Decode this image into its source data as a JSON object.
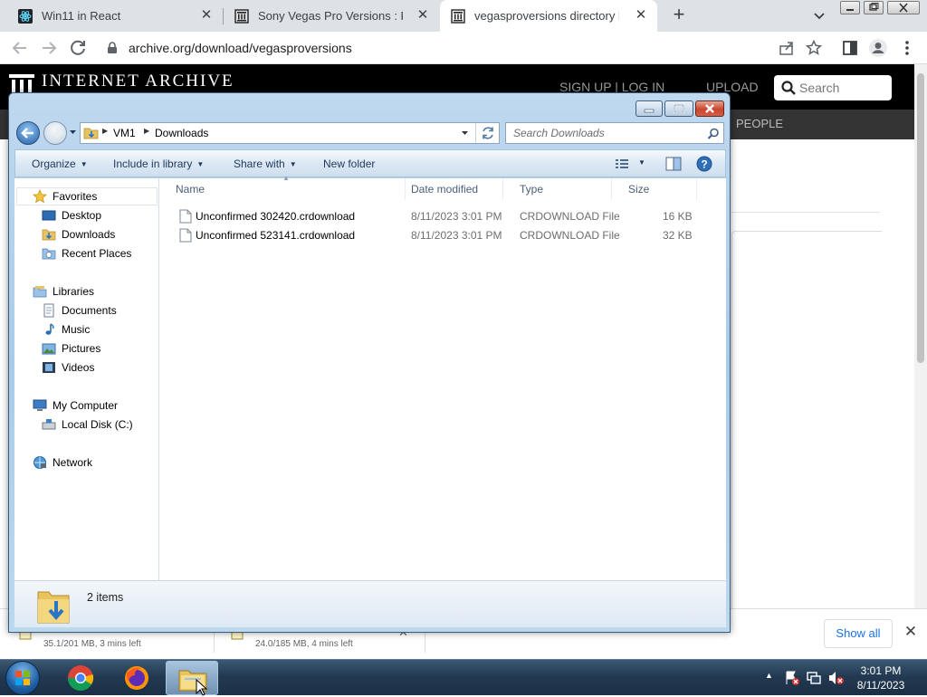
{
  "browser": {
    "tabs": [
      {
        "title": "Win11 in React"
      },
      {
        "title": "Sony Vegas Pro Versions : Free D"
      },
      {
        "title": "vegasproversions directory listin"
      }
    ],
    "url": "archive.org/download/vegasproversions"
  },
  "archive": {
    "logo_text": "INTERNET ARCHIVE",
    "signup_label": "SIGN UP | LOG IN",
    "upload_label": "UPLOAD",
    "search_placeholder": "Search",
    "subnav_people": "PEOPLE"
  },
  "downloads_shelf": {
    "items": [
      {
        "status": "35.1/201 MB, 3 mins left"
      },
      {
        "status": "24.0/185 MB, 4 mins left"
      }
    ],
    "show_all_label": "Show all"
  },
  "explorer": {
    "breadcrumb": [
      "VM1",
      "Downloads"
    ],
    "search_placeholder": "Search Downloads",
    "commands": {
      "organize": "Organize",
      "include_in_library": "Include in library",
      "share_with": "Share with",
      "new_folder": "New folder"
    },
    "nav": {
      "favorites": {
        "label": "Favorites",
        "items": [
          "Desktop",
          "Downloads",
          "Recent Places"
        ]
      },
      "libraries": {
        "label": "Libraries",
        "items": [
          "Documents",
          "Music",
          "Pictures",
          "Videos"
        ]
      },
      "computer": {
        "label": "My Computer",
        "items": [
          "Local Disk (C:)"
        ]
      },
      "network": {
        "label": "Network"
      }
    },
    "columns": [
      "Name",
      "Date modified",
      "Type",
      "Size"
    ],
    "files": [
      {
        "name": "Unconfirmed 302420.crdownload",
        "date": "8/11/2023 3:01 PM",
        "type": "CRDOWNLOAD File",
        "size": "16 KB"
      },
      {
        "name": "Unconfirmed 523141.crdownload",
        "date": "8/11/2023 3:01 PM",
        "type": "CRDOWNLOAD File",
        "size": "32 KB"
      }
    ],
    "item_count": "2 items"
  },
  "taskbar": {
    "time": "3:01 PM",
    "date": "8/11/2023"
  },
  "colors": {
    "chrome_tabbar": "#dee1e6",
    "archive_header": "#000000",
    "explorer_frame": "#a9cbe8",
    "taskbar": "#233a52",
    "link_blue": "#1a73e8"
  }
}
